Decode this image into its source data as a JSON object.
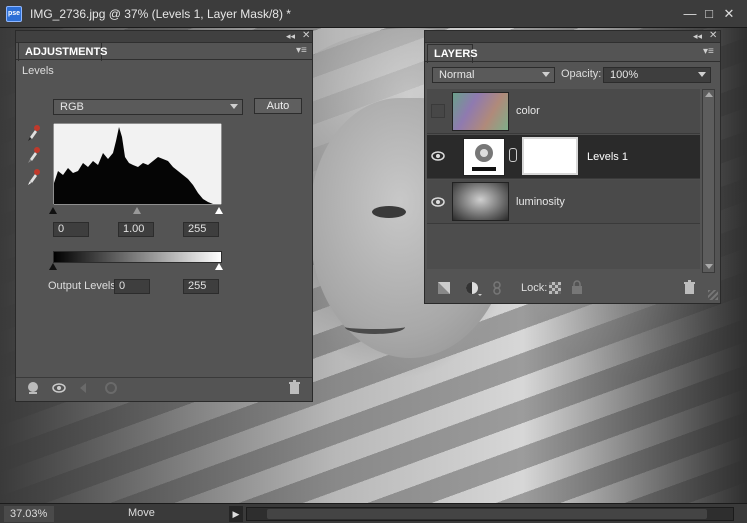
{
  "window": {
    "title": "IMG_2736.jpg @ 37% (Levels 1, Layer Mask/8) *",
    "app_icon_text": "pse"
  },
  "status": {
    "zoom": "37.03%",
    "tool": "Move"
  },
  "adjustments": {
    "tab": "ADJUSTMENTS",
    "subtitle": "Levels",
    "channel": "RGB",
    "auto_label": "Auto",
    "input_black": "0",
    "input_gamma": "1.00",
    "input_white": "255",
    "output_label": "Output Levels:",
    "output_black": "0",
    "output_white": "255"
  },
  "layers": {
    "tab": "LAYERS",
    "blend_mode": "Normal",
    "opacity_label": "Opacity:",
    "opacity_value": "100%",
    "items": [
      {
        "name": "color",
        "visible": false,
        "selected": false
      },
      {
        "name": "Levels 1",
        "visible": true,
        "selected": true
      },
      {
        "name": "luminosity",
        "visible": true,
        "selected": false
      }
    ],
    "lock_label": "Lock:"
  },
  "colors": {
    "accent": "#2d6fd6",
    "panel": "#545454",
    "selected_row": "#2a2a2a"
  }
}
